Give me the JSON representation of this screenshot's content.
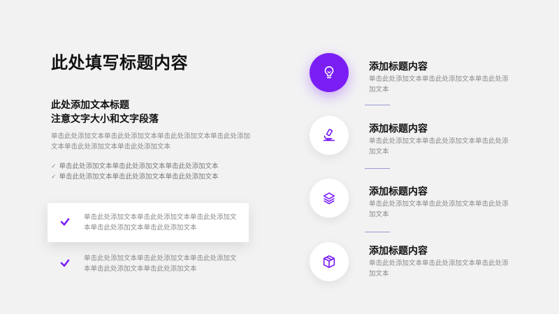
{
  "main_title": "此处填写标题内容",
  "subtitle_line1": "此处添加文本标题",
  "subtitle_line2": "注意文字大小和文字段落",
  "description": "单击此处添加文本单击此处添加文本单击此处添加文本单击此处添加文本单击此处添加文本单击此处添加文本",
  "checklist": [
    "单击此处添加文本单击此处添加文本单击此处添加文本",
    "单击此处添加文本单击此处添加文本单击此处添加文本"
  ],
  "cards": [
    {
      "text": "单击此处添加文本单击此处添加文本单击此处添加文本单击此处添加文本单击此处添加文本"
    },
    {
      "text": "单击此处添加文本单击此处添加文本单击此处添加文本单击此处添加文本单击此处添加文本"
    }
  ],
  "accent_color": "#7a1ef5",
  "items": [
    {
      "icon": "lightbulb-icon",
      "title": "添加标题内容",
      "text": "单击此处添加文本单击此处添加文本单击此处添加文本"
    },
    {
      "icon": "microscope-icon",
      "title": "添加标题内容",
      "text": "单击此处添加文本单击此处添加文本单击此处添加文本"
    },
    {
      "icon": "layers-icon",
      "title": "添加标题内容",
      "text": "单击此处添加文本单击此处添加文本单击此处添加文本"
    },
    {
      "icon": "box-icon",
      "title": "添加标题内容",
      "text": "单击此处添加文本单击此处添加文本单击此处添加文本"
    }
  ]
}
